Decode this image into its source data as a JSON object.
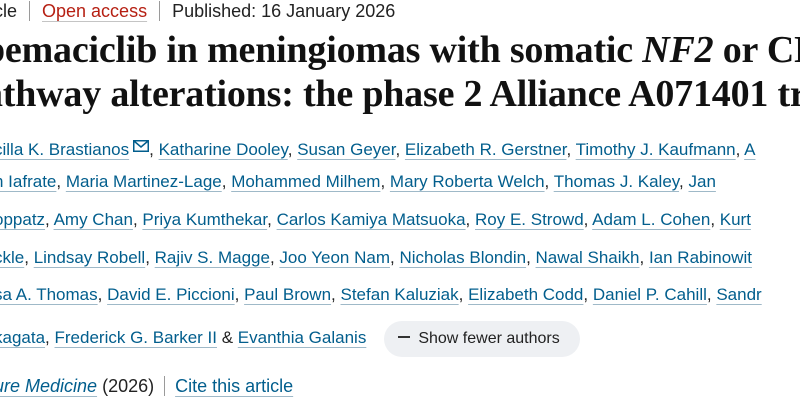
{
  "meta": {
    "article_type": "cle",
    "open_access": "Open access",
    "published": "Published: 16 January 2026"
  },
  "title": {
    "line1_a": "bemaciclib in meningiomas with somatic ",
    "line1_gene": "NF2",
    "line1_b": " or CD",
    "line2": "athway alterations: the phase 2 Alliance A071401 tri"
  },
  "authors": {
    "rows": [
      [
        {
          "name": "cilla K. Brastianos",
          "sep": ""
        },
        {
          "name": "Katharine Dooley",
          "sep": ","
        },
        {
          "name": "Susan Geyer",
          "sep": ","
        },
        {
          "name": "Elizabeth R. Gerstner",
          "sep": ","
        },
        {
          "name": "Timothy J. Kaufmann",
          "sep": ","
        },
        {
          "name": "A",
          "sep": ""
        }
      ],
      [
        {
          "name": "n Iafrate",
          "sep": ","
        },
        {
          "name": "Maria Martinez-Lage",
          "sep": ","
        },
        {
          "name": "Mohammed Milhem",
          "sep": ","
        },
        {
          "name": "Mary Roberta Welch",
          "sep": ","
        },
        {
          "name": "Thomas J. Kaley",
          "sep": ","
        },
        {
          "name": "Jan",
          "sep": ""
        }
      ],
      [
        {
          "name": "oppatz",
          "sep": ","
        },
        {
          "name": "Amy Chan",
          "sep": ","
        },
        {
          "name": "Priya Kumthekar",
          "sep": ","
        },
        {
          "name": "Carlos Kamiya Matsuoka",
          "sep": ","
        },
        {
          "name": "Roy E. Strowd",
          "sep": ","
        },
        {
          "name": "Adam L. Cohen",
          "sep": ","
        },
        {
          "name": "Kurt",
          "sep": ""
        }
      ],
      [
        {
          "name": "ckle",
          "sep": ","
        },
        {
          "name": "Lindsay Robell",
          "sep": ","
        },
        {
          "name": "Rajiv S. Magge",
          "sep": ","
        },
        {
          "name": "Joo Yeon Nam",
          "sep": ","
        },
        {
          "name": "Nicholas Blondin",
          "sep": ","
        },
        {
          "name": "Nawal Shaikh",
          "sep": ","
        },
        {
          "name": "Ian Rabinowit",
          "sep": ""
        }
      ],
      [
        {
          "name": "sa A. Thomas",
          "sep": ","
        },
        {
          "name": "David E. Piccioni",
          "sep": ","
        },
        {
          "name": "Paul Brown",
          "sep": ","
        },
        {
          "name": "Stefan Kaluziak",
          "sep": ","
        },
        {
          "name": "Elizabeth Codd",
          "sep": ","
        },
        {
          "name": "Daniel P. Cahill",
          "sep": ","
        },
        {
          "name": "Sandr",
          "sep": ""
        }
      ]
    ],
    "last_row": {
      "a1": "kagata",
      "a2": "Frederick G. Barker II",
      "amp": "&",
      "a3": "Evanthia Galanis",
      "show_fewer": "Show fewer authors"
    }
  },
  "journal": {
    "name": "ure Medicine",
    "year": "(2026)",
    "cite": "Cite this article"
  },
  "icons": {
    "mail": "envelope-icon",
    "collapse": "minus-icon"
  },
  "colors": {
    "link": "#025e8d",
    "open_access": "#b62013",
    "pill_bg": "#eef0f3"
  }
}
